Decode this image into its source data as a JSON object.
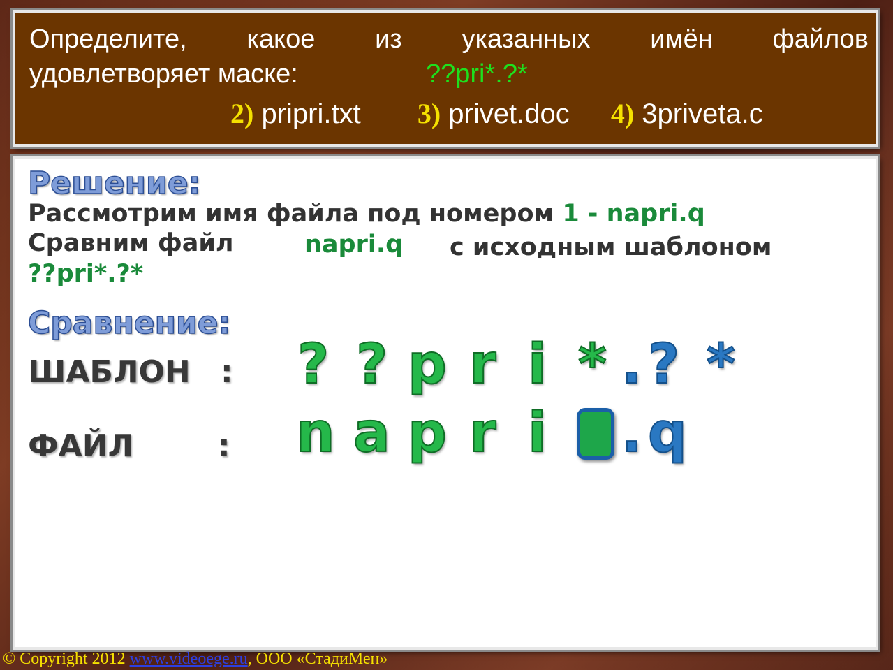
{
  "question": {
    "line1_words": [
      "Определите,",
      "какое",
      "из",
      "указанных",
      "имён",
      "файлов"
    ],
    "line2": "удовлетворяет маске:",
    "mask": "??pri*.?*",
    "options": [
      {
        "num": "2)",
        "text": "pripri.txt"
      },
      {
        "num": "3)",
        "text": "privet.doc"
      },
      {
        "num": "4)",
        "text": "3priveta.c"
      }
    ]
  },
  "solution": {
    "heading": "Решение:",
    "line1_text": "Рассмотрим имя файла под номером",
    "line1_highlight": "1 - napri.q",
    "line2_text_a": "Сравним файл",
    "line2_file": "napri.q",
    "line2_text_b": "с исходным шаблоном",
    "line3_mask": "??pri*.?*"
  },
  "comparison": {
    "heading": "Сравнение:",
    "template_label": "ШАБЛОН",
    "file_label": "ФАЙЛ",
    "colon": ":",
    "template_glyphs": [
      "?",
      "?",
      "p",
      "r",
      "i",
      "*",
      ".",
      "?",
      "*"
    ],
    "file_glyphs": [
      "n",
      "a",
      "p",
      "r",
      "i",
      ".",
      "q"
    ]
  },
  "footer": {
    "copyright": "© Copyright 2012",
    "link": "www.videoege.ru",
    "company": ", ООО «СтадиМен»"
  },
  "colors": {
    "question_bg": "#6b3500",
    "mask_green": "#1ee01e",
    "option_number": "#f5e100",
    "heading_blue": "#7e9cd8",
    "glyph_green": "#25b84a",
    "glyph_blue": "#2a78c2"
  }
}
